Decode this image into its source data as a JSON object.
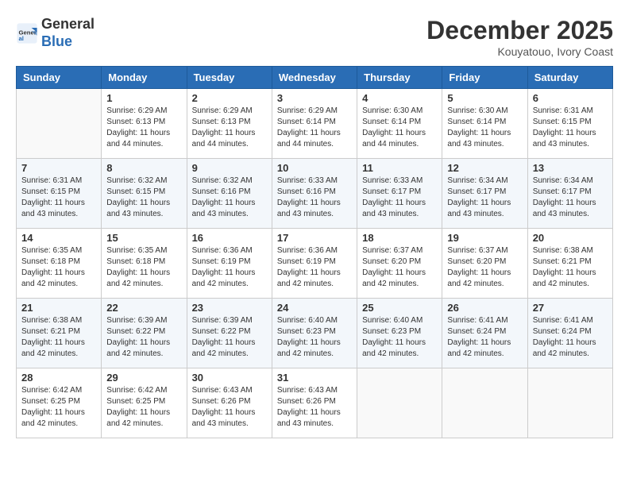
{
  "header": {
    "logo_general": "General",
    "logo_blue": "Blue",
    "month_title": "December 2025",
    "subtitle": "Kouyatouo, Ivory Coast"
  },
  "weekdays": [
    "Sunday",
    "Monday",
    "Tuesday",
    "Wednesday",
    "Thursday",
    "Friday",
    "Saturday"
  ],
  "weeks": [
    [
      {
        "day": "",
        "sunrise": "",
        "sunset": "",
        "daylight": ""
      },
      {
        "day": "1",
        "sunrise": "Sunrise: 6:29 AM",
        "sunset": "Sunset: 6:13 PM",
        "daylight": "Daylight: 11 hours and 44 minutes."
      },
      {
        "day": "2",
        "sunrise": "Sunrise: 6:29 AM",
        "sunset": "Sunset: 6:13 PM",
        "daylight": "Daylight: 11 hours and 44 minutes."
      },
      {
        "day": "3",
        "sunrise": "Sunrise: 6:29 AM",
        "sunset": "Sunset: 6:14 PM",
        "daylight": "Daylight: 11 hours and 44 minutes."
      },
      {
        "day": "4",
        "sunrise": "Sunrise: 6:30 AM",
        "sunset": "Sunset: 6:14 PM",
        "daylight": "Daylight: 11 hours and 44 minutes."
      },
      {
        "day": "5",
        "sunrise": "Sunrise: 6:30 AM",
        "sunset": "Sunset: 6:14 PM",
        "daylight": "Daylight: 11 hours and 43 minutes."
      },
      {
        "day": "6",
        "sunrise": "Sunrise: 6:31 AM",
        "sunset": "Sunset: 6:15 PM",
        "daylight": "Daylight: 11 hours and 43 minutes."
      }
    ],
    [
      {
        "day": "7",
        "sunrise": "Sunrise: 6:31 AM",
        "sunset": "Sunset: 6:15 PM",
        "daylight": "Daylight: 11 hours and 43 minutes."
      },
      {
        "day": "8",
        "sunrise": "Sunrise: 6:32 AM",
        "sunset": "Sunset: 6:15 PM",
        "daylight": "Daylight: 11 hours and 43 minutes."
      },
      {
        "day": "9",
        "sunrise": "Sunrise: 6:32 AM",
        "sunset": "Sunset: 6:16 PM",
        "daylight": "Daylight: 11 hours and 43 minutes."
      },
      {
        "day": "10",
        "sunrise": "Sunrise: 6:33 AM",
        "sunset": "Sunset: 6:16 PM",
        "daylight": "Daylight: 11 hours and 43 minutes."
      },
      {
        "day": "11",
        "sunrise": "Sunrise: 6:33 AM",
        "sunset": "Sunset: 6:17 PM",
        "daylight": "Daylight: 11 hours and 43 minutes."
      },
      {
        "day": "12",
        "sunrise": "Sunrise: 6:34 AM",
        "sunset": "Sunset: 6:17 PM",
        "daylight": "Daylight: 11 hours and 43 minutes."
      },
      {
        "day": "13",
        "sunrise": "Sunrise: 6:34 AM",
        "sunset": "Sunset: 6:17 PM",
        "daylight": "Daylight: 11 hours and 43 minutes."
      }
    ],
    [
      {
        "day": "14",
        "sunrise": "Sunrise: 6:35 AM",
        "sunset": "Sunset: 6:18 PM",
        "daylight": "Daylight: 11 hours and 42 minutes."
      },
      {
        "day": "15",
        "sunrise": "Sunrise: 6:35 AM",
        "sunset": "Sunset: 6:18 PM",
        "daylight": "Daylight: 11 hours and 42 minutes."
      },
      {
        "day": "16",
        "sunrise": "Sunrise: 6:36 AM",
        "sunset": "Sunset: 6:19 PM",
        "daylight": "Daylight: 11 hours and 42 minutes."
      },
      {
        "day": "17",
        "sunrise": "Sunrise: 6:36 AM",
        "sunset": "Sunset: 6:19 PM",
        "daylight": "Daylight: 11 hours and 42 minutes."
      },
      {
        "day": "18",
        "sunrise": "Sunrise: 6:37 AM",
        "sunset": "Sunset: 6:20 PM",
        "daylight": "Daylight: 11 hours and 42 minutes."
      },
      {
        "day": "19",
        "sunrise": "Sunrise: 6:37 AM",
        "sunset": "Sunset: 6:20 PM",
        "daylight": "Daylight: 11 hours and 42 minutes."
      },
      {
        "day": "20",
        "sunrise": "Sunrise: 6:38 AM",
        "sunset": "Sunset: 6:21 PM",
        "daylight": "Daylight: 11 hours and 42 minutes."
      }
    ],
    [
      {
        "day": "21",
        "sunrise": "Sunrise: 6:38 AM",
        "sunset": "Sunset: 6:21 PM",
        "daylight": "Daylight: 11 hours and 42 minutes."
      },
      {
        "day": "22",
        "sunrise": "Sunrise: 6:39 AM",
        "sunset": "Sunset: 6:22 PM",
        "daylight": "Daylight: 11 hours and 42 minutes."
      },
      {
        "day": "23",
        "sunrise": "Sunrise: 6:39 AM",
        "sunset": "Sunset: 6:22 PM",
        "daylight": "Daylight: 11 hours and 42 minutes."
      },
      {
        "day": "24",
        "sunrise": "Sunrise: 6:40 AM",
        "sunset": "Sunset: 6:23 PM",
        "daylight": "Daylight: 11 hours and 42 minutes."
      },
      {
        "day": "25",
        "sunrise": "Sunrise: 6:40 AM",
        "sunset": "Sunset: 6:23 PM",
        "daylight": "Daylight: 11 hours and 42 minutes."
      },
      {
        "day": "26",
        "sunrise": "Sunrise: 6:41 AM",
        "sunset": "Sunset: 6:24 PM",
        "daylight": "Daylight: 11 hours and 42 minutes."
      },
      {
        "day": "27",
        "sunrise": "Sunrise: 6:41 AM",
        "sunset": "Sunset: 6:24 PM",
        "daylight": "Daylight: 11 hours and 42 minutes."
      }
    ],
    [
      {
        "day": "28",
        "sunrise": "Sunrise: 6:42 AM",
        "sunset": "Sunset: 6:25 PM",
        "daylight": "Daylight: 11 hours and 42 minutes."
      },
      {
        "day": "29",
        "sunrise": "Sunrise: 6:42 AM",
        "sunset": "Sunset: 6:25 PM",
        "daylight": "Daylight: 11 hours and 42 minutes."
      },
      {
        "day": "30",
        "sunrise": "Sunrise: 6:43 AM",
        "sunset": "Sunset: 6:26 PM",
        "daylight": "Daylight: 11 hours and 43 minutes."
      },
      {
        "day": "31",
        "sunrise": "Sunrise: 6:43 AM",
        "sunset": "Sunset: 6:26 PM",
        "daylight": "Daylight: 11 hours and 43 minutes."
      },
      {
        "day": "",
        "sunrise": "",
        "sunset": "",
        "daylight": ""
      },
      {
        "day": "",
        "sunrise": "",
        "sunset": "",
        "daylight": ""
      },
      {
        "day": "",
        "sunrise": "",
        "sunset": "",
        "daylight": ""
      }
    ]
  ]
}
